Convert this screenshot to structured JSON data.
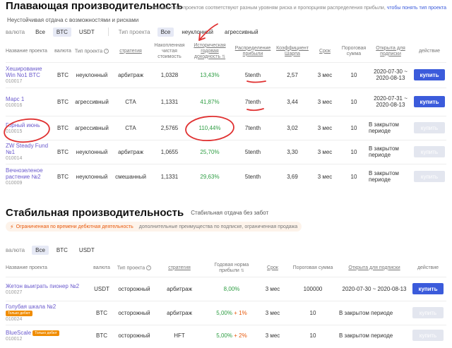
{
  "floating": {
    "title": "Плавающая производительность",
    "right_note": "Разные типы проектов соответствуют разным уровням риска и пропорциям распределения прибыли,",
    "right_link": "чтобы понять тип проекта",
    "subtitle": "Неустойчивая отдача с возможностями и рисками",
    "filter_currency_label": "валюта",
    "currency_options": [
      "Все",
      "BTC",
      "USDT"
    ],
    "filter_type_label": "Тип проекта",
    "type_options": [
      "Все",
      "неуклонный",
      "агрессивный"
    ],
    "columns": [
      "Название проекта",
      "валюта",
      "Тип проекта",
      "стратегия",
      "Накопленная чистая стоимость",
      "Историческая годовая доходность",
      "Распределение прибыли",
      "Коэффициент Шарпа",
      "Срок",
      "Пороговая сумма",
      "Открыта для подписки",
      "действие"
    ],
    "rows": [
      {
        "name": "Хеширование Win No1 BTC",
        "code": "010017",
        "currency": "BTC",
        "type": "неуклонный",
        "strategy": "арбитраж",
        "nav": "1,0328",
        "yield": "13,43%",
        "profit": "5tenth",
        "sharpe": "2,57",
        "term": "3 мес",
        "threshold": "10",
        "open": "2020-07-30 ~ 2020-08-13",
        "action": "купить",
        "active": true
      },
      {
        "name": "Марс 1",
        "code": "010016",
        "currency": "BTC",
        "type": "агрессивный",
        "strategy": "СТА",
        "nav": "1,1331",
        "yield": "41,87%",
        "profit": "7tenth",
        "sharpe": "3,44",
        "term": "3 мес",
        "threshold": "10",
        "open": "2020-07-31 ~ 2020-08-13",
        "action": "купить",
        "active": true
      },
      {
        "name": "Горный июнь",
        "code": "010015",
        "currency": "BTC",
        "type": "агрессивный",
        "strategy": "СТА",
        "nav": "2,5765",
        "yield": "110,44%",
        "profit": "7tenth",
        "sharpe": "3,02",
        "term": "3 мес",
        "threshold": "10",
        "open": "В закрытом периоде",
        "action": "купить",
        "active": false
      },
      {
        "name": "ZW Steady Fund №1",
        "code": "010014",
        "currency": "BTC",
        "type": "неуклонный",
        "strategy": "арбитраж",
        "nav": "1,0655",
        "yield": "25,70%",
        "profit": "5tenth",
        "sharpe": "3,30",
        "term": "3 мес",
        "threshold": "10",
        "open": "В закрытом периоде",
        "action": "купить",
        "active": false
      },
      {
        "name": "Вечнозеленое растение №2",
        "code": "010009",
        "currency": "BTC",
        "type": "неуклонный",
        "strategy": "смешанный",
        "nav": "1,1331",
        "yield": "29,63%",
        "profit": "5tenth",
        "sharpe": "3,69",
        "term": "3 мес",
        "threshold": "10",
        "open": "В закрытом периоде",
        "action": "купить",
        "active": false
      }
    ]
  },
  "stable": {
    "title": "Стабильная производительность",
    "subtitle": "Стабильная отдача без забот",
    "notice_warn": "Ограниченная по времени дебютная деятельность",
    "notice_note": "дополнительные преимущества по подписке, ограниченная продажа",
    "filter_currency_label": "валюта",
    "currency_options": [
      "Все",
      "BTC",
      "USDT"
    ],
    "columns": [
      "Название проекта",
      "валюта",
      "Тип проекта",
      "стратегия",
      "Годовая норма прибыли",
      "Срок",
      "Пороговая сумма",
      "Открыта для подписки",
      "действие"
    ],
    "rows": [
      {
        "name": "Жетон выиграть пионер №2",
        "code": "010027",
        "badge": "",
        "currency": "USDT",
        "type": "осторожный",
        "strategy": "арбитраж",
        "rate": "8,00%",
        "bonus": "",
        "term": "3 мес",
        "threshold": "100000",
        "open": "2020-07-30 ~ 2020-08-13",
        "action": "купить",
        "active": true
      },
      {
        "name": "Голубая шкала №2",
        "code": "010024",
        "badge": "Только дебют",
        "currency": "BTC",
        "type": "осторожный",
        "strategy": "арбитраж",
        "rate": "5,00%",
        "bonus": "+ 1%",
        "term": "3 мес",
        "threshold": "10",
        "open": "В закрытом периоде",
        "action": "купить",
        "active": false
      },
      {
        "name": "BlueScale",
        "code": "010012",
        "badge": "Только дебют",
        "currency": "BTC",
        "type": "осторожный",
        "strategy": "HFT",
        "rate": "5,00%",
        "bonus": "+ 2%",
        "term": "3 мес",
        "threshold": "10",
        "open": "В закрытом периоде",
        "action": "купить",
        "active": false
      }
    ]
  },
  "colors": {
    "accent": "#3b5bdb",
    "link": "#6a5acd",
    "green": "#2f9e44",
    "annotation": "#e03131"
  }
}
